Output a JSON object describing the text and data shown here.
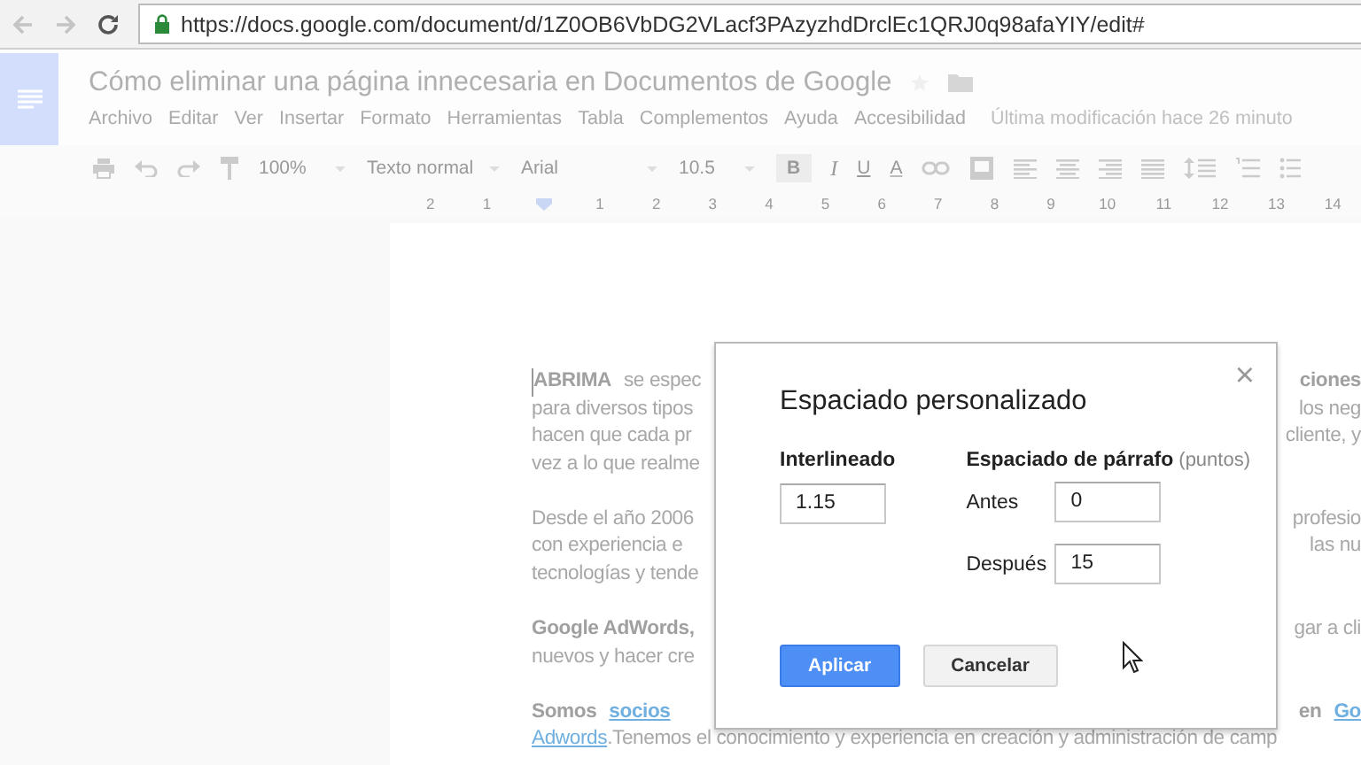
{
  "browser": {
    "url": "https://docs.google.com/document/d/1Z0OB6VbDG2VLacf3PAzyzhdDrclEc1QRJ0q98afaYIY/edit#"
  },
  "document": {
    "title": "Cómo eliminar una página innecesaria en Documentos de Google",
    "menu": [
      "Archivo",
      "Editar",
      "Ver",
      "Insertar",
      "Formato",
      "Herramientas",
      "Tabla",
      "Complementos",
      "Ayuda",
      "Accesibilidad"
    ],
    "last_modified": "Última modificación hace 26 minuto"
  },
  "toolbar": {
    "zoom": "100%",
    "style": "Texto normal",
    "font": "Arial",
    "font_size": "10.5",
    "bold": "B",
    "italic": "I",
    "underline": "U",
    "text_color": "A"
  },
  "ruler": [
    "2",
    "1",
    "1",
    "2",
    "3",
    "4",
    "5",
    "6",
    "7",
    "8",
    "9",
    "10",
    "11",
    "12",
    "13",
    "14"
  ],
  "page": {
    "paragraphs": [
      {
        "lines": [
          {
            "left": [
              {
                "text": "ABRIMA",
                "kind": "bold"
              },
              {
                "text": "se espec",
                "kind": "plain"
              }
            ],
            "right": [
              {
                "text": "ciones",
                "kind": "bold"
              }
            ]
          },
          {
            "left": [
              {
                "text": "para diversos tipos",
                "kind": "plain"
              }
            ],
            "right": [
              {
                "text": "los neg",
                "kind": "plain"
              }
            ]
          },
          {
            "left": [
              {
                "text": "hacen que cada pr",
                "kind": "plain"
              }
            ],
            "right": [
              {
                "text": "cliente, y",
                "kind": "plain"
              }
            ]
          },
          {
            "left": [
              {
                "text": "vez a lo que realme",
                "kind": "plain"
              }
            ]
          }
        ]
      },
      {
        "lines": [
          {
            "left": [
              {
                "text": "Desde el año 2006",
                "kind": "plain"
              }
            ],
            "right": [
              {
                "text": "profesio",
                "kind": "plain"
              }
            ]
          },
          {
            "left": [
              {
                "text": "con experiencia e",
                "kind": "plain"
              }
            ],
            "right": [
              {
                "text": "las nu",
                "kind": "plain"
              }
            ]
          },
          {
            "left": [
              {
                "text": "tecnologías y tende",
                "kind": "plain"
              }
            ]
          }
        ]
      },
      {
        "lines": [
          {
            "left": [
              {
                "text": "Google AdWords,",
                "kind": "bold"
              }
            ],
            "right": [
              {
                "text": "gar a cli",
                "kind": "plain"
              }
            ]
          },
          {
            "left": [
              {
                "text": "nuevos y hacer cre",
                "kind": "plain"
              }
            ]
          }
        ]
      },
      {
        "lines": [
          {
            "left": [
              {
                "text": "Somos",
                "kind": "bold"
              },
              {
                "text": "socios",
                "kind": "link"
              }
            ],
            "right": [
              {
                "text": "en",
                "kind": "bold"
              },
              {
                "text": "Go",
                "kind": "link"
              }
            ]
          },
          {
            "left": [
              {
                "text": "Adwords",
                "kind": "link"
              },
              {
                "text": ".Tenemos el conocimiento y experiencia en creación y administración de camp",
                "kind": "plain"
              }
            ]
          }
        ]
      }
    ]
  },
  "dialog": {
    "title": "Espaciado personalizado",
    "close": "×",
    "line_spacing": {
      "label": "Interlineado",
      "value": "1.15"
    },
    "paragraph_spacing": {
      "label": "Espaciado de párrafo",
      "unit": "(puntos)",
      "before": {
        "label": "Antes",
        "value": "0"
      },
      "after": {
        "label": "Después",
        "value": "15"
      }
    },
    "buttons": [
      {
        "label": "Aplicar",
        "kind": "primary"
      },
      {
        "label": "Cancelar",
        "kind": "secondary"
      }
    ]
  }
}
